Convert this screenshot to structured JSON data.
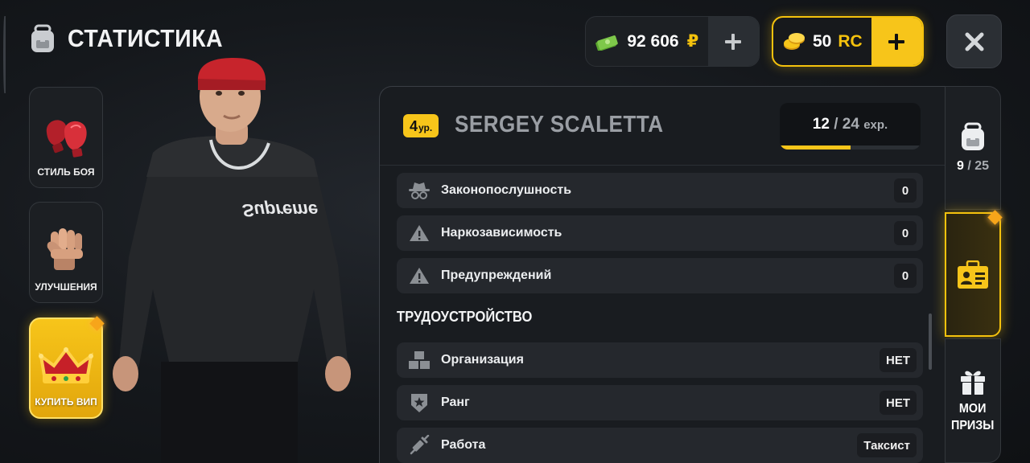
{
  "header": {
    "title": "СТАТИСТИКА",
    "icon": "backpack-icon"
  },
  "currency": {
    "money": {
      "amount": "92 606",
      "symbol": "₽",
      "icon": "cash-stack-icon"
    },
    "rc": {
      "amount": "50",
      "unit": "RC",
      "icon": "gold-coins-icon"
    }
  },
  "left_menu": [
    {
      "label": "СТИЛЬ БОЯ",
      "icon": "boxing-gloves-icon"
    },
    {
      "label": "УЛУЧШЕНИЯ",
      "icon": "fist-icon"
    },
    {
      "label": "КУПИТЬ ВИП",
      "icon": "crown-icon"
    }
  ],
  "character": {
    "shirt_text": "Supreme"
  },
  "player": {
    "level_number": "4",
    "level_suffix": "ур.",
    "name": "SERGEY SCALETTA",
    "exp_current": "12",
    "exp_separator": "/",
    "exp_max": "24",
    "exp_unit": "exp.",
    "exp_progress": 0.5
  },
  "stats": [
    {
      "label": "Законопослушность",
      "value": "0",
      "icon": "spy-hat-icon"
    },
    {
      "label": "Наркозависимость",
      "value": "0",
      "icon": "warning-triangle-icon"
    },
    {
      "label": "Предупреждений",
      "value": "0",
      "icon": "warning-triangle-icon"
    }
  ],
  "employment": {
    "title": "ТРУДОУСТРОЙСТВО",
    "rows": [
      {
        "label": "Организация",
        "value": "НЕТ",
        "icon": "boxes-icon"
      },
      {
        "label": "Ранг",
        "value": "НЕТ",
        "icon": "rank-badge-icon"
      },
      {
        "label": "Работа",
        "value": "Таксист",
        "icon": "syringe-icon"
      }
    ]
  },
  "right_tabs": {
    "inventory": {
      "count": "9",
      "separator": "/",
      "max": "25",
      "icon": "backpack-icon"
    },
    "id_card": {
      "icon": "id-card-icon"
    },
    "prizes": {
      "label_line1": "МОИ",
      "label_line2": "ПРИЗЫ",
      "icon": "gift-icon"
    }
  },
  "colors": {
    "accent": "#f7c51a",
    "panel": "#191c20",
    "row": "#25282d",
    "money_green": "#7ec84a"
  }
}
